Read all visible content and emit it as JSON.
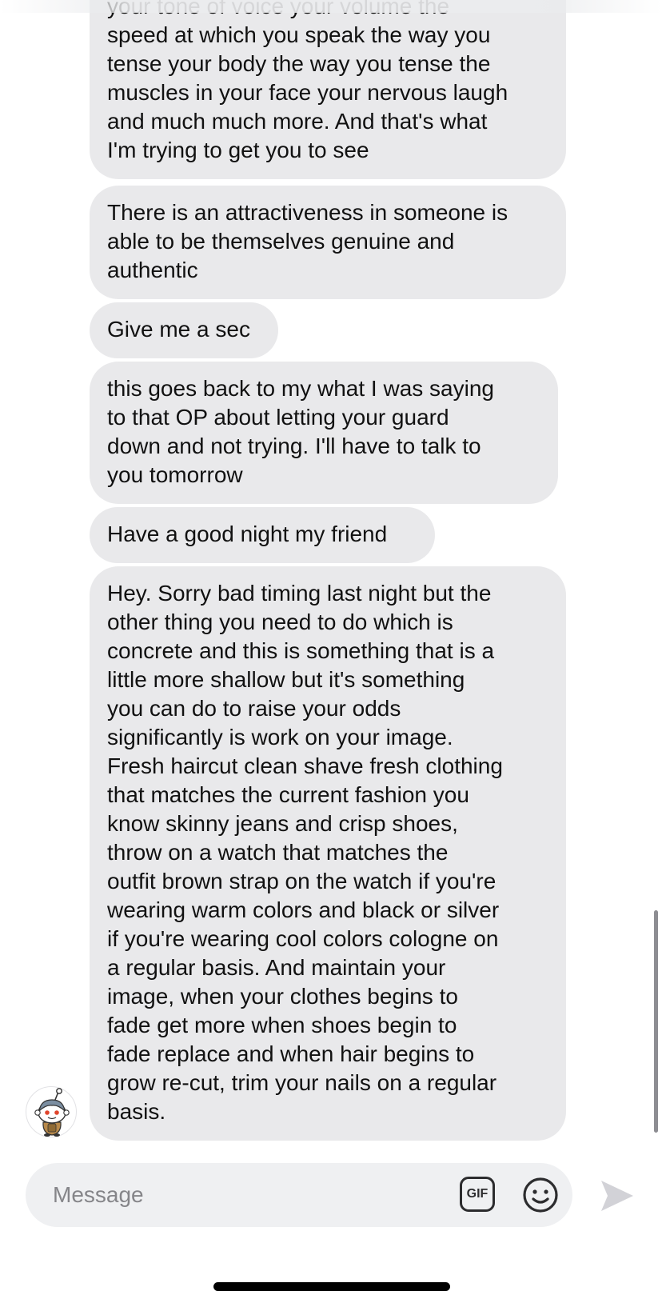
{
  "messages": [
    {
      "id": "m1",
      "text": "your tone of voice your volume the\nspeed at which you speak the way you\ntense your body the way you tense the\nmuscles in your face your nervous laugh\nand much much more. And that's what\nI'm trying to get you to see"
    },
    {
      "id": "m2",
      "text": "There is an attractiveness in someone is\nable to be themselves genuine and\nauthentic"
    },
    {
      "id": "m3",
      "text": "Give me a sec"
    },
    {
      "id": "m4",
      "text": "this goes back to my what I was saying\nto that OP about letting your guard\ndown and not trying. I'll have to talk to\nyou tomorrow"
    },
    {
      "id": "m5",
      "text": "Have a good night my friend"
    },
    {
      "id": "m6",
      "text": "Hey. Sorry bad timing last night but the\nother thing you need to do which is\nconcrete and this is something that is a\nlittle more shallow but it's something\nyou can do to raise your odds\nsignificantly is work on your image.\nFresh haircut clean shave fresh clothing\nthat matches the current fashion you\nknow skinny jeans  and crisp shoes,\nthrow on a watch that matches the\noutfit brown strap on the watch if you're\nwearing warm colors and black or silver\nif you're wearing cool colors cologne on\na regular basis. And maintain your\nimage, when your clothes begins to\nfade get more when shoes begin to\nfade replace and when hair begins to\ngrow re-cut, trim your nails on a regular\nbasis."
    }
  ],
  "sender_avatar": {
    "icon": "snoo-avatar-icon"
  },
  "composer": {
    "placeholder": "Message",
    "gif_label": "GIF",
    "emoji_icon": "smiley-face-icon",
    "send_icon": "send-arrow-icon"
  },
  "colors": {
    "bubble_background": "#e9e9eb",
    "composer_background": "#eff0f2",
    "placeholder_text": "#858589",
    "send_disabled": "#d2d2d7"
  }
}
